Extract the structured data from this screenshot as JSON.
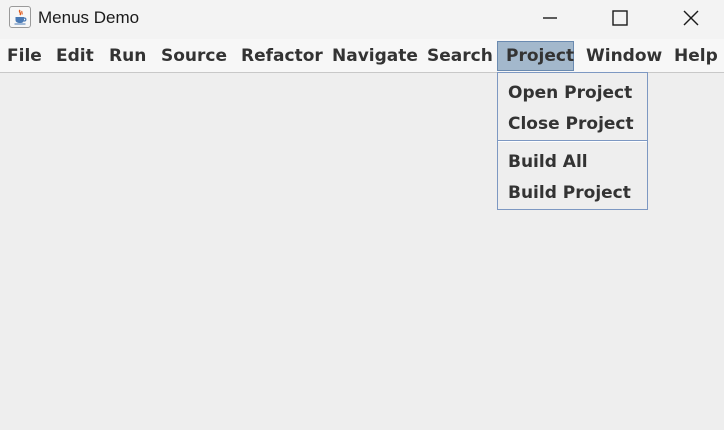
{
  "window": {
    "title": "Menus Demo"
  },
  "menubar": {
    "items": [
      {
        "label": "File"
      },
      {
        "label": "Edit"
      },
      {
        "label": "Run"
      },
      {
        "label": "Source"
      },
      {
        "label": "Refactor"
      },
      {
        "label": "Navigate"
      },
      {
        "label": "Search"
      },
      {
        "label": "Project",
        "active": true
      },
      {
        "label": "Window"
      },
      {
        "label": "Help"
      }
    ]
  },
  "dropdown": {
    "groups": [
      [
        "Open Project",
        "Close Project"
      ],
      [
        "Build All",
        "Build Project"
      ]
    ]
  },
  "icons": {
    "app": "java-cup-icon",
    "minimize": "minimize-icon",
    "maximize": "maximize-icon",
    "close": "close-icon"
  },
  "colors": {
    "active_menu_bg": "#a3b8cc",
    "menu_border": "#7d98c2",
    "window_bg": "#eeeeee"
  }
}
